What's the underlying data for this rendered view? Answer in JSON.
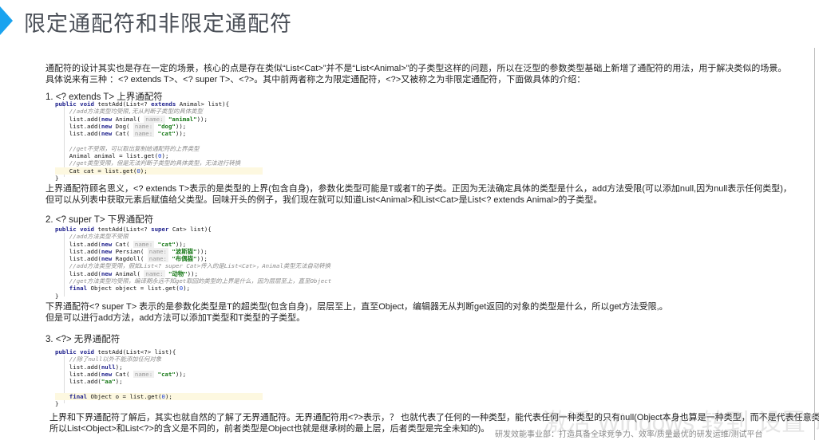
{
  "title": "限定通配符和非限定通配符",
  "intro": [
    "通配符的设计其实也是存在一定的场景，核心的点是存在类似“List<Cat>”并不是“List<Animal>”的子类型这样的问题，所以在泛型的参数类型基础上新增了通配符的用法，用于解决类似的场景。",
    "具体说来有三种 ：<? extends T>、<? super T>、<?>。其中前两者称之为限定通配符，<?>又被称之为非限定通配符，下面做具体的介绍："
  ],
  "sections": [
    {
      "heading": "1. <? extends T> 上界通配符",
      "code": [
        [
          [
            "kw",
            "public void "
          ],
          [
            "",
            "testAdd(List<? "
          ],
          [
            "kw",
            "extends "
          ],
          [
            "",
            "Animal> list){"
          ]
        ],
        [
          [
            "cm",
            "    //add方法类型均受限,无从判断子类型的具体类型"
          ]
        ],
        [
          [
            "",
            "    list.add("
          ],
          [
            "kw",
            "new "
          ],
          [
            "",
            "Animal( "
          ],
          [
            "hint",
            "name:"
          ],
          [
            "str",
            " \"animal\""
          ],
          [
            "",
            "));"
          ]
        ],
        [
          [
            "",
            "    list.add("
          ],
          [
            "kw",
            "new "
          ],
          [
            "",
            "Dog( "
          ],
          [
            "hint",
            "name:"
          ],
          [
            "str",
            " \"dog\""
          ],
          [
            "",
            "));"
          ]
        ],
        [
          [
            "",
            "    list.add("
          ],
          [
            "kw",
            "new "
          ],
          [
            "",
            "Cat( "
          ],
          [
            "hint",
            "name:"
          ],
          [
            "str",
            " \"cat\""
          ],
          [
            "",
            "));"
          ]
        ],
        [
          [
            "",
            ""
          ]
        ],
        [
          [
            "cm",
            "    //get不受限，可以取出复制给通配符的上界类型"
          ]
        ],
        [
          [
            "",
            "    Animal animal = list.get("
          ],
          [
            "num",
            "0"
          ],
          [
            "",
            ");"
          ]
        ],
        [
          [
            "cm",
            "    //get类型受限，但是无法判断子类型的具体类型，无法进行转换"
          ]
        ],
        [
          [
            "hl",
            ""
          ],
          [
            "",
            "    Cat cat = list.get("
          ],
          [
            "num",
            "0"
          ],
          [
            "",
            ");"
          ]
        ],
        [
          [
            "",
            "}"
          ]
        ]
      ],
      "paragraph": [
        "上界通配符顾名思义，<? extends T>表示的是类型的上界(包含自身)，参数化类型可能是T或者T的子类。正因为无法确定具体的类型是什么，add方法受限(可以添加null,因为null表示任何类型)，",
        "但可以从列表中获取元素后赋值给父类型。回味开头的例子，我们现在就可以知道List<Animal>和List<Cat>是List<? extends Animal>的子类型。"
      ]
    },
    {
      "heading": "2. <? super T> 下界通配符",
      "code": [
        [
          [
            "kw",
            "public void "
          ],
          [
            "",
            "testAdd(List<? "
          ],
          [
            "kw",
            "super "
          ],
          [
            "",
            "Cat> list){"
          ]
        ],
        [
          [
            "cm",
            "    //add方法类型不受限"
          ]
        ],
        [
          [
            "",
            "    list.add("
          ],
          [
            "kw",
            "new "
          ],
          [
            "",
            "Cat( "
          ],
          [
            "hint",
            "name:"
          ],
          [
            "str",
            " \"cat\""
          ],
          [
            "",
            "));"
          ]
        ],
        [
          [
            "",
            "    list.add("
          ],
          [
            "kw",
            "new "
          ],
          [
            "",
            "Persian( "
          ],
          [
            "hint",
            "name:"
          ],
          [
            "str",
            " \"波斯猫\""
          ],
          [
            "",
            "));"
          ]
        ],
        [
          [
            "",
            "    list.add("
          ],
          [
            "kw",
            "new "
          ],
          [
            "",
            "Ragdoll( "
          ],
          [
            "hint",
            "name:"
          ],
          [
            "str",
            " \"布偶猫\""
          ],
          [
            "",
            "));"
          ]
        ],
        [
          [
            "cm",
            "    //add方法类型受限，假如List<? super Cat>传入的是List<Cat>，Animal类型无法自动转换"
          ]
        ],
        [
          [
            "",
            "    list.add("
          ],
          [
            "kw",
            "new "
          ],
          [
            "",
            "Animal( "
          ],
          [
            "hint",
            "name:"
          ],
          [
            "str",
            " \"动物\""
          ],
          [
            "",
            "));"
          ]
        ],
        [
          [
            "cm",
            "    //get方法类型均受限，编译期永远不知get取回的类型的上界是什么，因为层层至上，直至Object"
          ]
        ],
        [
          [
            "kw",
            "    final "
          ],
          [
            "",
            "Object object = list.get("
          ],
          [
            "num",
            "0"
          ],
          [
            "",
            ");"
          ]
        ],
        [
          [
            "",
            "}"
          ]
        ]
      ],
      "paragraph": [
        "下界通配符<? super T> 表示的是参数化类型是T的超类型(包含自身)，层层至上，直至Object，编辑器无从判断get返回的对象的类型是什么，所以get方法受限,。",
        "但是可以进行add方法，add方法可以添加T类型和T类型的子类型。"
      ]
    },
    {
      "heading": "3. <?> 无界通配符",
      "code": [
        [
          [
            "kw",
            "public void "
          ],
          [
            "",
            "testAdd(List<?> list){"
          ]
        ],
        [
          [
            "cm",
            "    //除了null以外不能添加任何对象"
          ]
        ],
        [
          [
            "",
            "    list.add("
          ],
          [
            "kw",
            "null"
          ],
          [
            "",
            ");"
          ]
        ],
        [
          [
            "",
            "    list.add("
          ],
          [
            "kw",
            "new "
          ],
          [
            "",
            "Cat( "
          ],
          [
            "hint",
            "name:"
          ],
          [
            "str",
            " \"cat\""
          ],
          [
            "",
            "));"
          ]
        ],
        [
          [
            "",
            "    list.add("
          ],
          [
            "str",
            "\"aa\""
          ],
          [
            "",
            ");"
          ]
        ],
        [
          [
            "",
            ""
          ]
        ],
        [
          [
            "hl",
            ""
          ],
          [
            "kw",
            "    final "
          ],
          [
            "",
            "Object o = list.get("
          ],
          [
            "num",
            "0"
          ],
          [
            "",
            ");"
          ]
        ],
        [
          [
            "",
            "}"
          ]
        ]
      ],
      "paragraph": [
        "上界和下界通配符了解后，其实也就自然的了解了无界通配符。无界通配符用<?>表示，？ 也就代表了任何的一种类型，能代表任何一种类型的只有null(Object本身也算是一种类型，而不是代表任意类型",
        "所以List<Object>和List<?>的含义是不同的，前者类型是Object也就是继承树的最上层，后者类型是完全未知的)。"
      ]
    }
  ],
  "footer_watermark": "研发效能事业部：打造具备全球竞争力、效率/质量最优的研发运维/测试平台",
  "activation_watermark": "激活 Windows 转到\"设置\"以激活"
}
